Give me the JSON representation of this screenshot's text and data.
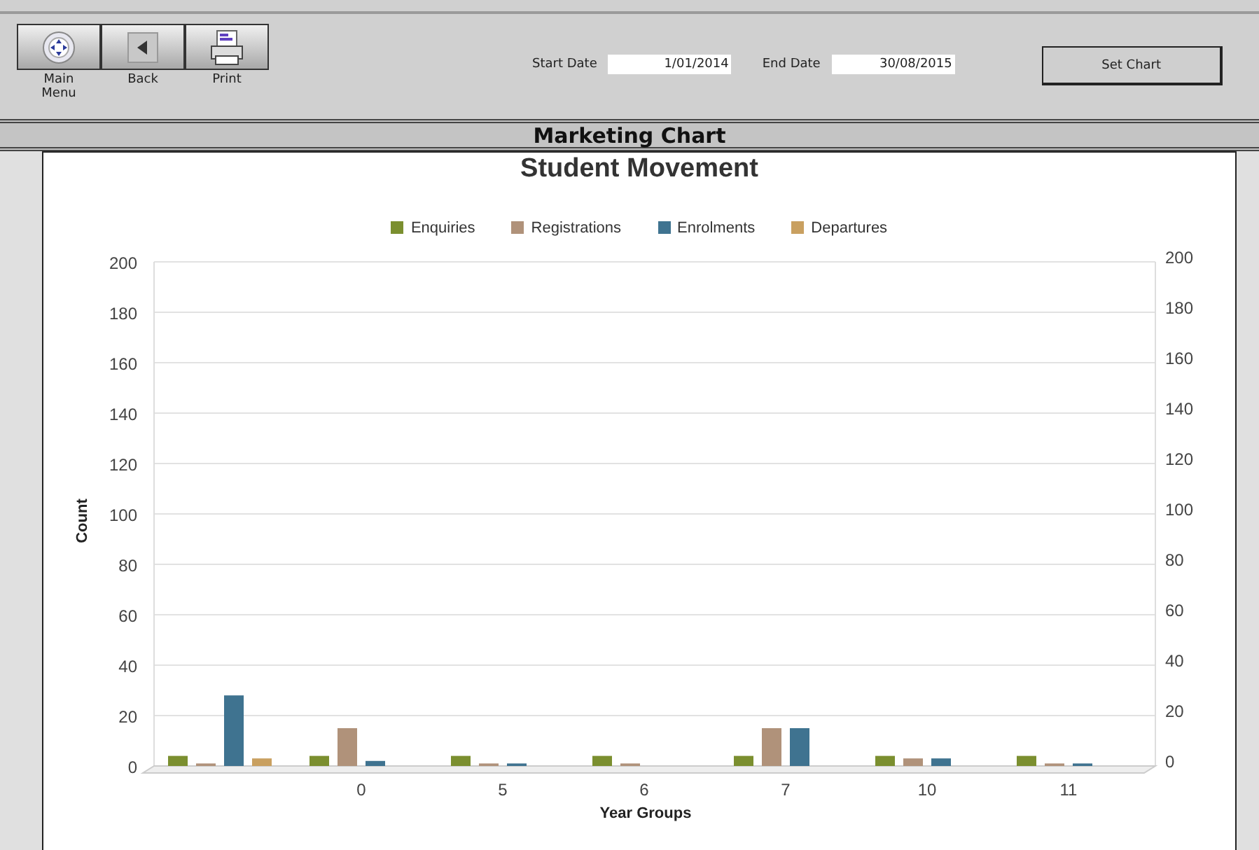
{
  "toolbar": {
    "buttons": [
      {
        "kind": "menu",
        "label": "Main Menu"
      },
      {
        "kind": "back",
        "label": "Back"
      },
      {
        "kind": "print",
        "label": "Print"
      }
    ]
  },
  "date_range": {
    "start_label": "Start Date",
    "start_value": "1/01/2014",
    "end_label": "End Date",
    "end_value": "30/08/2015",
    "button": "Set Chart"
  },
  "header": {
    "title": "Marketing Chart"
  },
  "chart": {
    "chart_data": {
      "type": "bar",
      "title": "Student Movement",
      "xlabel": "Year Groups",
      "ylabel": "Count",
      "categories": [
        null,
        "0",
        "5",
        "6",
        "7",
        "10",
        "11"
      ],
      "series": [
        {
          "name": "Enquiries",
          "color": "#7b8f2f",
          "values": [
            4,
            4,
            4,
            4,
            4,
            4,
            4
          ]
        },
        {
          "name": "Registrations",
          "color": "#b0927a",
          "values": [
            1,
            15,
            1,
            1,
            15,
            3,
            1
          ]
        },
        {
          "name": "Enrolments",
          "color": "#3f7390",
          "values": [
            28,
            2,
            1,
            0,
            15,
            3,
            1
          ]
        },
        {
          "name": "Departures",
          "color": "#c9a060",
          "values": [
            3,
            0,
            0,
            0,
            0,
            0,
            0
          ]
        }
      ],
      "ylim": [
        0,
        200
      ],
      "yticks": [
        0,
        20,
        40,
        60,
        80,
        100,
        120,
        140,
        160,
        180,
        200
      ],
      "y2lim": [
        0,
        200
      ],
      "y2ticks": [
        0,
        20,
        40,
        60,
        80,
        100,
        120,
        140,
        160,
        180,
        200
      ],
      "grid": true
    }
  }
}
